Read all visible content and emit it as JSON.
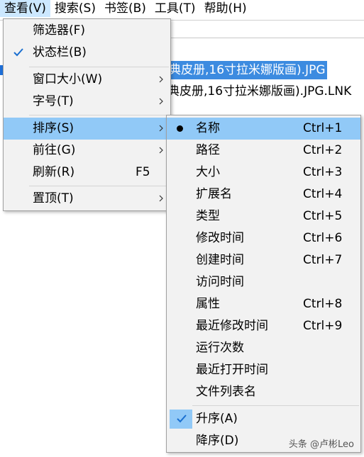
{
  "menubar": {
    "items": [
      "查看(V)",
      "搜索(S)",
      "书签(B)",
      "工具(T)",
      "帮助(H)"
    ]
  },
  "files": {
    "row1": "典皮册,16寸拉米娜版画).JPG",
    "row2": "典皮册,16寸拉米娜版画).JPG.LNK"
  },
  "view_menu": {
    "filter": "筛选器(F)",
    "statusbar": "状态栏(B)",
    "window_size": "窗口大小(W)",
    "font_size": "字号(T)",
    "sort": "排序(S)",
    "goto": "前往(G)",
    "refresh": "刷新(R)",
    "refresh_shortcut": "F5",
    "pin": "置顶(T)"
  },
  "sort_menu": {
    "items": [
      {
        "label": "名称",
        "shortcut": "Ctrl+1"
      },
      {
        "label": "路径",
        "shortcut": "Ctrl+2"
      },
      {
        "label": "大小",
        "shortcut": "Ctrl+3"
      },
      {
        "label": "扩展名",
        "shortcut": "Ctrl+4"
      },
      {
        "label": "类型",
        "shortcut": "Ctrl+5"
      },
      {
        "label": "修改时间",
        "shortcut": "Ctrl+6"
      },
      {
        "label": "创建时间",
        "shortcut": "Ctrl+7"
      },
      {
        "label": "访问时间",
        "shortcut": ""
      },
      {
        "label": "属性",
        "shortcut": "Ctrl+8"
      },
      {
        "label": "最近修改时间",
        "shortcut": "Ctrl+9"
      },
      {
        "label": "运行次数",
        "shortcut": ""
      },
      {
        "label": "最近打开时间",
        "shortcut": ""
      },
      {
        "label": "文件列表名",
        "shortcut": ""
      }
    ],
    "ascending": "升序(A)",
    "descending": "降序(D)"
  },
  "watermark": "头条 @卢彬Leo",
  "colors": {
    "highlight": "#91c9f7",
    "menubar_active": "#cce8ff",
    "selection": "#3c8be0",
    "menu_bg": "#f2f2f2"
  }
}
